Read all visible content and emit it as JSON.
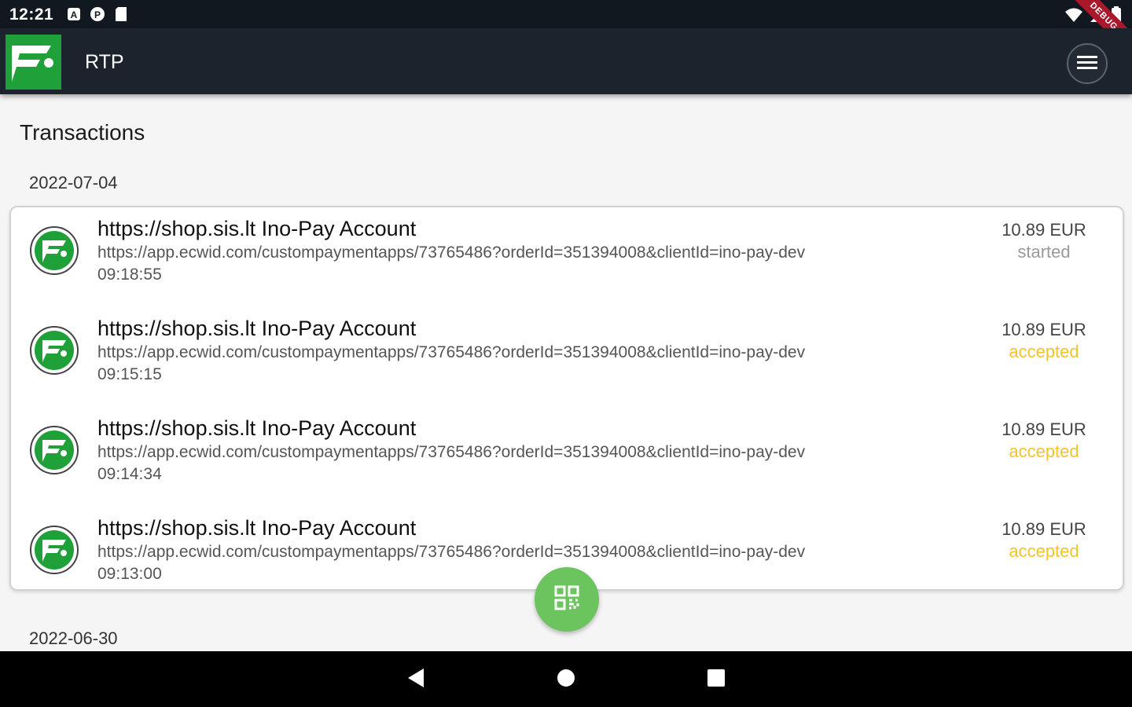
{
  "status_bar": {
    "time": "12:21",
    "icons": [
      "a-notification-icon",
      "p-notification-icon",
      "sd-card-icon"
    ],
    "right_icons": [
      "wifi-icon",
      "signal-icon",
      "battery-icon"
    ],
    "debug_banner": "DEBUG"
  },
  "app_bar": {
    "title": "RTP",
    "menu_icon": "menu-icon"
  },
  "page": {
    "title": "Transactions"
  },
  "groups": [
    {
      "date": "2022-07-04",
      "transactions": [
        {
          "merchant": "https://shop.sis.lt Ino-Pay Account",
          "url": "https://app.ecwid.com/custompaymentapps/73765486?orderId=351394008&clientId=ino-pay-dev",
          "time": "09:18:55",
          "amount": "10.89 EUR",
          "status": "started"
        },
        {
          "merchant": "https://shop.sis.lt Ino-Pay Account",
          "url": "https://app.ecwid.com/custompaymentapps/73765486?orderId=351394008&clientId=ino-pay-dev",
          "time": "09:15:15",
          "amount": "10.89 EUR",
          "status": "accepted"
        },
        {
          "merchant": "https://shop.sis.lt Ino-Pay Account",
          "url": "https://app.ecwid.com/custompaymentapps/73765486?orderId=351394008&clientId=ino-pay-dev",
          "time": "09:14:34",
          "amount": "10.89 EUR",
          "status": "accepted"
        },
        {
          "merchant": "https://shop.sis.lt Ino-Pay Account",
          "url": "https://app.ecwid.com/custompaymentapps/73765486?orderId=351394008&clientId=ino-pay-dev",
          "time": "09:13:00",
          "amount": "10.89 EUR",
          "status": "accepted"
        }
      ]
    },
    {
      "date": "2022-06-30",
      "transactions": []
    }
  ],
  "fab": {
    "icon": "qr-code-icon"
  },
  "colors": {
    "brand_green": "#1fa038",
    "fab_green": "#6cc45f",
    "status_started": "#9a9a9a",
    "status_accepted": "#f3c32a",
    "appbar": "#1c232c"
  }
}
